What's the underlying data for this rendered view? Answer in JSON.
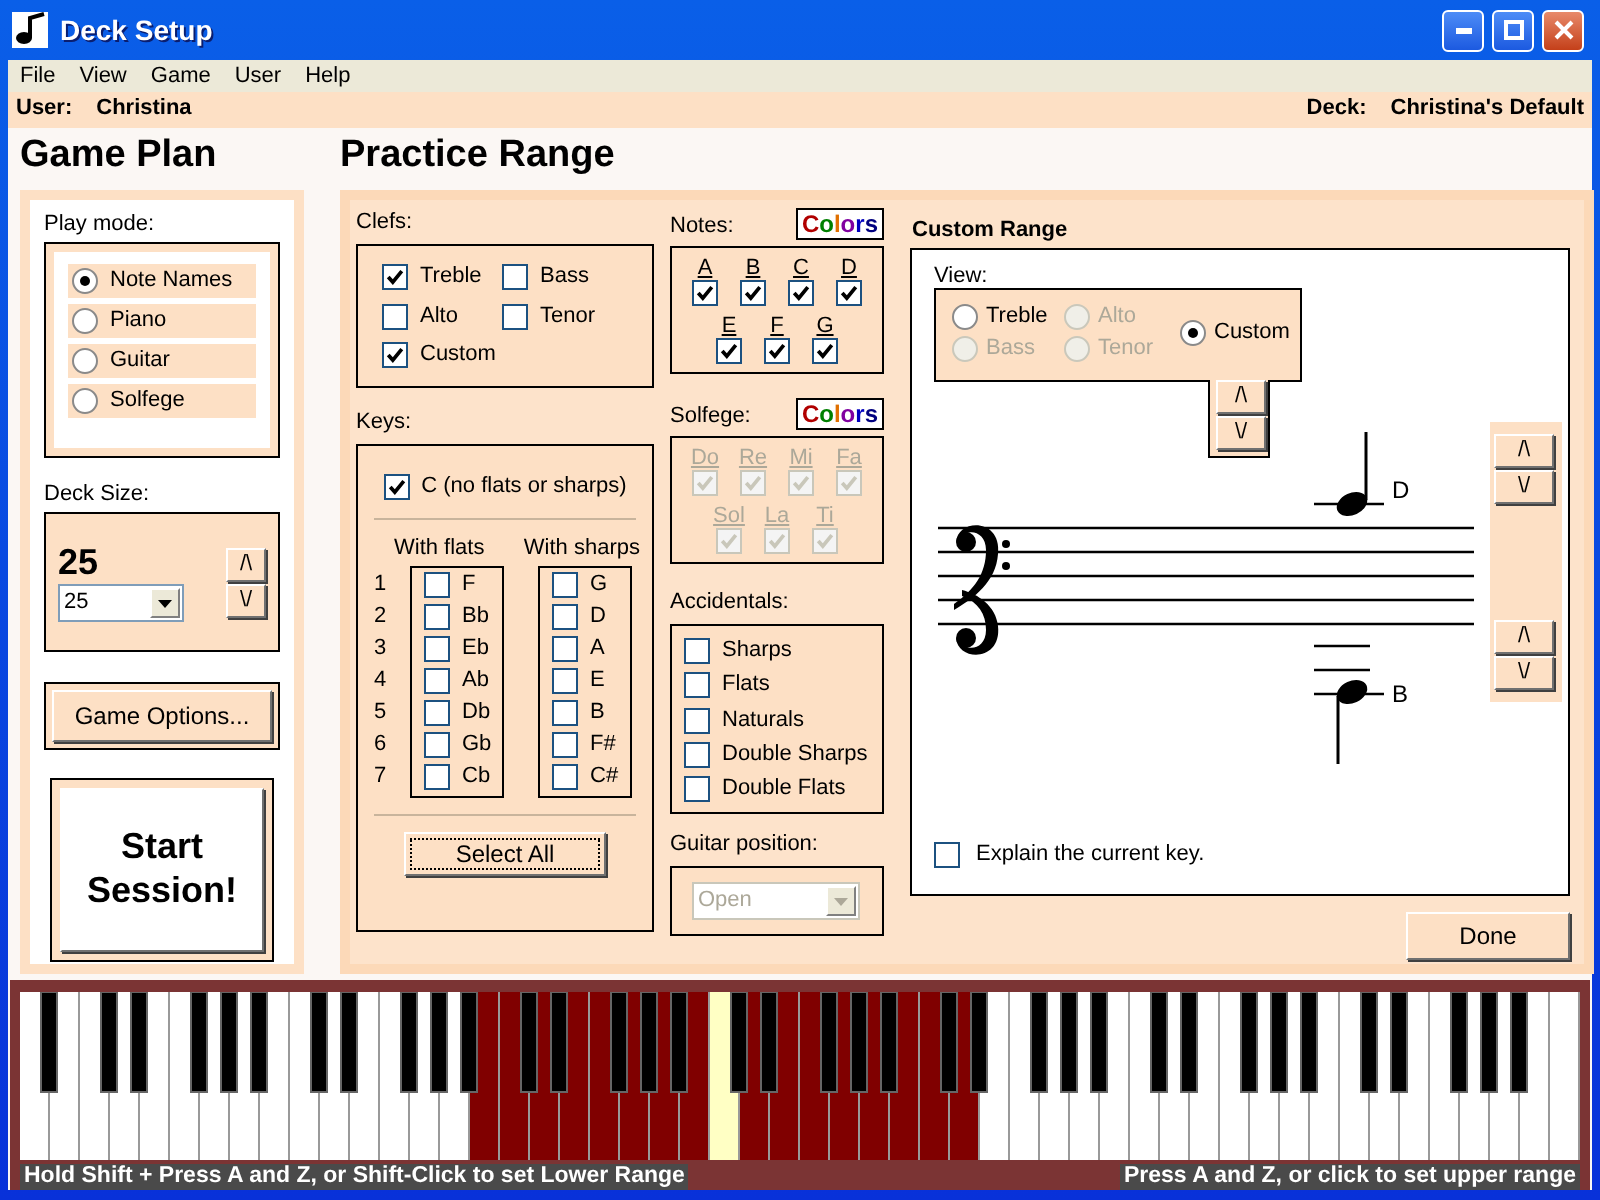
{
  "window": {
    "title": "Deck Setup"
  },
  "menu": [
    {
      "label": "File"
    },
    {
      "label": "View"
    },
    {
      "label": "Game"
    },
    {
      "label": "User"
    },
    {
      "label": "Help"
    }
  ],
  "user_bar": {
    "user_label": "User:",
    "user": "Christina",
    "deck_label": "Deck:",
    "deck": "Christina's Default"
  },
  "game_plan": {
    "heading": "Game Plan",
    "play_mode_label": "Play mode:",
    "play_modes": [
      {
        "label": "Note Names",
        "selected": true
      },
      {
        "label": "Piano",
        "selected": false
      },
      {
        "label": "Guitar",
        "selected": false
      },
      {
        "label": "Solfege",
        "selected": false
      }
    ],
    "deck_size_label": "Deck Size:",
    "deck_size": "25",
    "deck_size_select": "25",
    "up": "/\\",
    "down": "\\/",
    "game_options": "Game Options...",
    "start": "Start Session!"
  },
  "practice_range": {
    "heading": "Practice Range",
    "clefs": {
      "label": "Clefs:",
      "items": [
        {
          "label": "Treble",
          "checked": true
        },
        {
          "label": "Bass",
          "checked": false
        },
        {
          "label": "Alto",
          "checked": false
        },
        {
          "label": "Tenor",
          "checked": false
        },
        {
          "label": "Custom",
          "checked": true
        }
      ]
    },
    "keys": {
      "label": "Keys:",
      "natural": {
        "label": "C (no flats or sharps)",
        "checked": true
      },
      "flats_heading": "With flats",
      "sharps_heading": "With sharps",
      "rows": [
        {
          "number": "1",
          "flat": {
            "label": "F",
            "checked": false
          },
          "sharp": {
            "label": "G",
            "checked": false
          }
        },
        {
          "number": "2",
          "flat": {
            "label": "Bb",
            "checked": false
          },
          "sharp": {
            "label": "D",
            "checked": false
          }
        },
        {
          "number": "3",
          "flat": {
            "label": "Eb",
            "checked": false
          },
          "sharp": {
            "label": "A",
            "checked": false
          }
        },
        {
          "number": "4",
          "flat": {
            "label": "Ab",
            "checked": false
          },
          "sharp": {
            "label": "E",
            "checked": false
          }
        },
        {
          "number": "5",
          "flat": {
            "label": "Db",
            "checked": false
          },
          "sharp": {
            "label": "B",
            "checked": false
          }
        },
        {
          "number": "6",
          "flat": {
            "label": "Gb",
            "checked": false
          },
          "sharp": {
            "label": "F#",
            "checked": false
          }
        },
        {
          "number": "7",
          "flat": {
            "label": "Cb",
            "checked": false
          },
          "sharp": {
            "label": "C#",
            "checked": false
          }
        }
      ],
      "select_all": "Select All"
    },
    "notes": {
      "label": "Notes:",
      "colors_button": "Colors",
      "items": [
        {
          "label": "A",
          "checked": true
        },
        {
          "label": "B",
          "checked": true
        },
        {
          "label": "C",
          "checked": true
        },
        {
          "label": "D",
          "checked": true
        },
        {
          "label": "E",
          "checked": true
        },
        {
          "label": "F",
          "checked": true
        },
        {
          "label": "G",
          "checked": true
        }
      ]
    },
    "solfege": {
      "label": "Solfege:",
      "colors_button": "Colors",
      "items": [
        {
          "label": "Do",
          "checked": true,
          "disabled": true
        },
        {
          "label": "Re",
          "checked": true,
          "disabled": true
        },
        {
          "label": "Mi",
          "checked": true,
          "disabled": true
        },
        {
          "label": "Fa",
          "checked": true,
          "disabled": true
        },
        {
          "label": "Sol",
          "checked": true,
          "disabled": true
        },
        {
          "label": "La",
          "checked": true,
          "disabled": true
        },
        {
          "label": "Ti",
          "checked": true,
          "disabled": true
        }
      ]
    },
    "accidentals": {
      "label": "Accidentals:",
      "items": [
        {
          "label": "Sharps",
          "checked": false
        },
        {
          "label": "Flats",
          "checked": false
        },
        {
          "label": "Naturals",
          "checked": false
        },
        {
          "label": "Double Sharps",
          "checked": false
        },
        {
          "label": "Double Flats",
          "checked": false
        }
      ]
    },
    "guitar_position": {
      "label": "Guitar position:",
      "value": "Open",
      "disabled": true
    },
    "custom_range": {
      "heading": "Custom Range",
      "view_label": "View:",
      "views": [
        {
          "label": "Treble",
          "selected": false,
          "disabled": false
        },
        {
          "label": "Alto",
          "selected": false,
          "disabled": true
        },
        {
          "label": "Bass",
          "selected": false,
          "disabled": true
        },
        {
          "label": "Tenor",
          "selected": false,
          "disabled": true
        },
        {
          "label": "Custom",
          "selected": true,
          "disabled": false
        }
      ],
      "view_up": "/\\",
      "view_down": "\\/",
      "high_note": "D",
      "high_up": "/\\",
      "high_down": "\\/",
      "low_note": "B",
      "low_up": "/\\",
      "low_down": "\\/",
      "explain": {
        "label": "Explain the current key.",
        "checked": false
      }
    },
    "done": "Done"
  },
  "keyboard": {
    "white_keys": [
      {
        "in_range": false,
        "highlighted": false
      },
      {
        "in_range": false,
        "highlighted": false
      },
      {
        "in_range": false,
        "highlighted": false
      },
      {
        "in_range": false,
        "highlighted": false
      },
      {
        "in_range": false,
        "highlighted": false
      },
      {
        "in_range": false,
        "highlighted": false
      },
      {
        "in_range": false,
        "highlighted": false
      },
      {
        "in_range": false,
        "highlighted": false
      },
      {
        "in_range": false,
        "highlighted": false
      },
      {
        "in_range": false,
        "highlighted": false
      },
      {
        "in_range": false,
        "highlighted": false
      },
      {
        "in_range": false,
        "highlighted": false
      },
      {
        "in_range": false,
        "highlighted": false
      },
      {
        "in_range": false,
        "highlighted": false
      },
      {
        "in_range": false,
        "highlighted": false
      },
      {
        "in_range": true,
        "highlighted": false
      },
      {
        "in_range": true,
        "highlighted": false
      },
      {
        "in_range": true,
        "highlighted": false
      },
      {
        "in_range": true,
        "highlighted": false
      },
      {
        "in_range": true,
        "highlighted": false
      },
      {
        "in_range": true,
        "highlighted": false
      },
      {
        "in_range": true,
        "highlighted": false
      },
      {
        "in_range": true,
        "highlighted": false
      },
      {
        "in_range": true,
        "highlighted": true
      },
      {
        "in_range": true,
        "highlighted": false
      },
      {
        "in_range": true,
        "highlighted": false
      },
      {
        "in_range": true,
        "highlighted": false
      },
      {
        "in_range": true,
        "highlighted": false
      },
      {
        "in_range": true,
        "highlighted": false
      },
      {
        "in_range": true,
        "highlighted": false
      },
      {
        "in_range": true,
        "highlighted": false
      },
      {
        "in_range": true,
        "highlighted": false
      },
      {
        "in_range": false,
        "highlighted": false
      },
      {
        "in_range": false,
        "highlighted": false
      },
      {
        "in_range": false,
        "highlighted": false
      },
      {
        "in_range": false,
        "highlighted": false
      },
      {
        "in_range": false,
        "highlighted": false
      },
      {
        "in_range": false,
        "highlighted": false
      },
      {
        "in_range": false,
        "highlighted": false
      },
      {
        "in_range": false,
        "highlighted": false
      },
      {
        "in_range": false,
        "highlighted": false
      },
      {
        "in_range": false,
        "highlighted": false
      },
      {
        "in_range": false,
        "highlighted": false
      },
      {
        "in_range": false,
        "highlighted": false
      },
      {
        "in_range": false,
        "highlighted": false
      },
      {
        "in_range": false,
        "highlighted": false
      },
      {
        "in_range": false,
        "highlighted": false
      },
      {
        "in_range": false,
        "highlighted": false
      },
      {
        "in_range": false,
        "highlighted": false
      },
      {
        "in_range": false,
        "highlighted": false
      },
      {
        "in_range": false,
        "highlighted": false
      },
      {
        "in_range": false,
        "highlighted": false
      }
    ],
    "lower_hint": "Hold Shift + Press A and Z, or Shift-Click to set Lower Range",
    "upper_hint": "Press A and Z, or click to set upper range"
  }
}
